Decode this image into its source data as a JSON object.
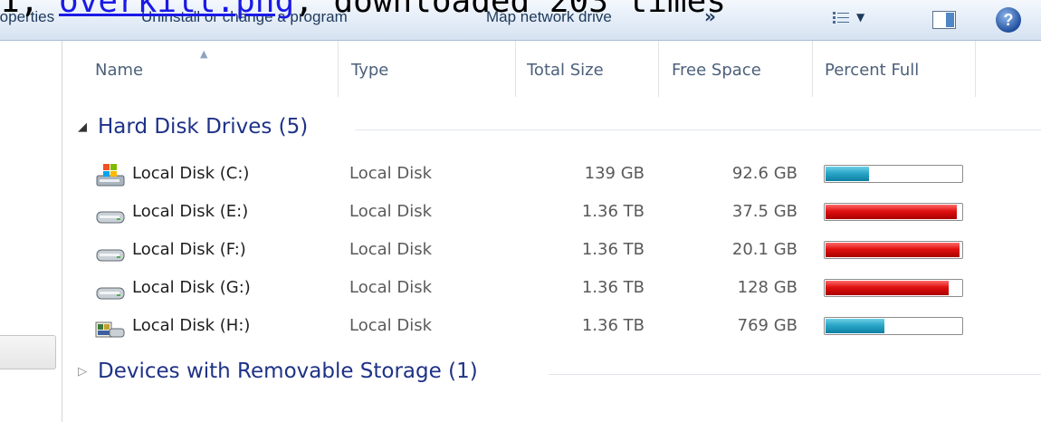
{
  "caption": {
    "prefix": "1, ",
    "link": "overkill.png",
    "suffix": ", downloaded 203 times"
  },
  "toolbar": {
    "items": [
      {
        "label": "roperties"
      },
      {
        "label": "Uninstall or change a program"
      },
      {
        "label": "Map network drive"
      }
    ],
    "more": "»",
    "view_arrow": "▼",
    "help": "?"
  },
  "columns": {
    "name": "Name",
    "type": "Type",
    "total": "Total Size",
    "free": "Free Space",
    "percent": "Percent Full"
  },
  "groups": {
    "hard": {
      "title": "Hard Disk Drives (5)"
    },
    "removable": {
      "title": "Devices with Removable Storage (1)"
    }
  },
  "drives": [
    {
      "name": "Local Disk (C:)",
      "type": "Local Disk",
      "total": "139 GB",
      "free": "92.6 GB",
      "percent_full": 0.33,
      "bar_color": "blue",
      "icon": "windows-drive-icon"
    },
    {
      "name": "Local Disk (E:)",
      "type": "Local Disk",
      "total": "1.36 TB",
      "free": "37.5 GB",
      "percent_full": 0.97,
      "bar_color": "red",
      "icon": "hard-drive-icon"
    },
    {
      "name": "Local Disk (F:)",
      "type": "Local Disk",
      "total": "1.36 TB",
      "free": "20.1 GB",
      "percent_full": 0.99,
      "bar_color": "red",
      "icon": "hard-drive-icon"
    },
    {
      "name": "Local Disk (G:)",
      "type": "Local Disk",
      "total": "1.36 TB",
      "free": "128 GB",
      "percent_full": 0.91,
      "bar_color": "red",
      "icon": "hard-drive-icon"
    },
    {
      "name": "Local Disk (H:)",
      "type": "Local Disk",
      "total": "1.36 TB",
      "free": "769 GB",
      "percent_full": 0.44,
      "bar_color": "blue",
      "icon": "media-drive-icon"
    }
  ],
  "colors": {
    "bar_blue": "#2aa7c8",
    "bar_red": "#e01010",
    "group_title": "#1e3287"
  }
}
